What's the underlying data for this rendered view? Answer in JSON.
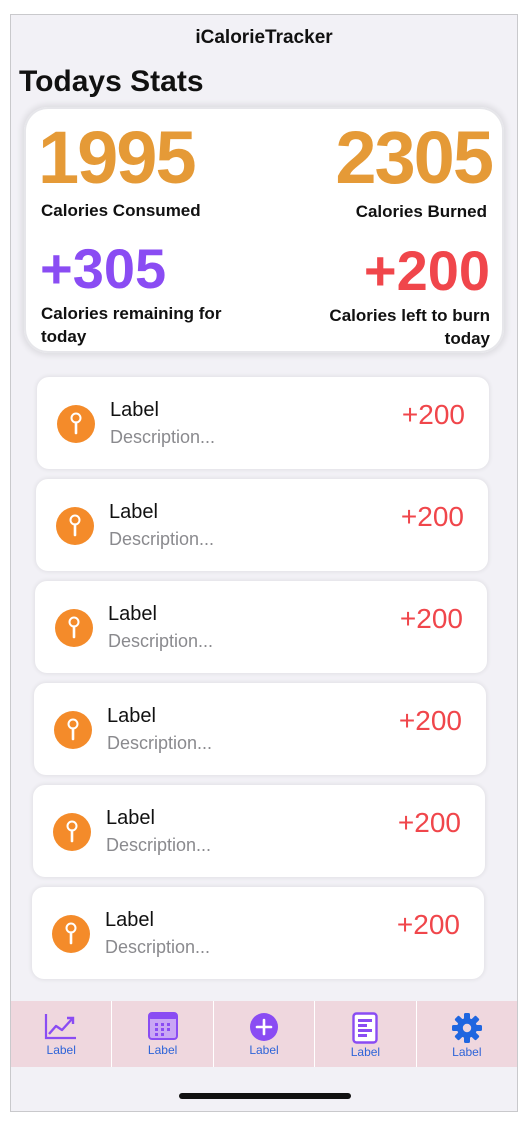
{
  "app": {
    "title": "iCalorieTracker"
  },
  "page": {
    "title": "Todays Stats"
  },
  "stats": {
    "consumed": {
      "value": "1995",
      "label": "Calories Consumed"
    },
    "burned": {
      "value": "2305",
      "label": "Calories Burned"
    },
    "remaining": {
      "value": "+305",
      "label": "Calories remaining for today"
    },
    "left_to_burn": {
      "value": "+200",
      "label": "Calories left to burn today"
    }
  },
  "entries": [
    {
      "label": "Label",
      "description": "Description...",
      "value": "+200",
      "icon": "pin-icon"
    },
    {
      "label": "Label",
      "description": "Description...",
      "value": "+200",
      "icon": "pin-icon"
    },
    {
      "label": "Label",
      "description": "Description...",
      "value": "+200",
      "icon": "pin-icon"
    },
    {
      "label": "Label",
      "description": "Description...",
      "value": "+200",
      "icon": "pin-icon"
    },
    {
      "label": "Label",
      "description": "Description...",
      "value": "+200",
      "icon": "pin-icon"
    },
    {
      "label": "Label",
      "description": "Description...",
      "value": "+200",
      "icon": "pin-icon"
    }
  ],
  "tabs": [
    {
      "label": "Label",
      "icon": "chart-line-icon"
    },
    {
      "label": "Label",
      "icon": "calendar-icon"
    },
    {
      "label": "Label",
      "icon": "plus-circle-icon"
    },
    {
      "label": "Label",
      "icon": "document-icon"
    },
    {
      "label": "Label",
      "icon": "gear-icon"
    }
  ],
  "colors": {
    "accent_orange": "#e59a37",
    "accent_purple": "#8a4cf3",
    "accent_red": "#f0464b",
    "icon_orange": "#f48b2a",
    "tab_bar_bg": "#efd7de",
    "tab_label": "#2e64d8"
  }
}
